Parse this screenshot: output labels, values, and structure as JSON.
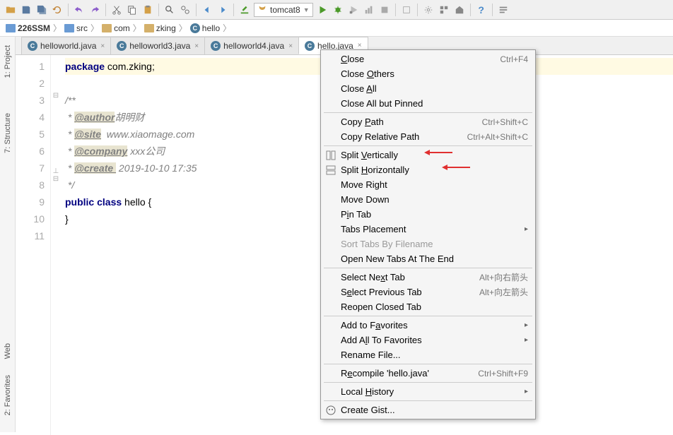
{
  "toolbar": {
    "tomcat_label": "tomcat8"
  },
  "breadcrumb": {
    "items": [
      "226SSM",
      "src",
      "com",
      "zking",
      "hello"
    ]
  },
  "tabs": [
    {
      "label": "helloworld.java",
      "active": false
    },
    {
      "label": "helloworld3.java",
      "active": false
    },
    {
      "label": "helloworld4.java",
      "active": false
    },
    {
      "label": "hello.java",
      "active": true
    }
  ],
  "side_tabs": {
    "project": "1: Project",
    "structure": "7: Structure",
    "web": "Web",
    "favorites": "2: Favorites"
  },
  "gutter_lines": [
    "1",
    "2",
    "3",
    "4",
    "5",
    "6",
    "7",
    "8",
    "9",
    "10",
    "11"
  ],
  "code": {
    "l1_kw": "package",
    "l1_pkg": " com.zking;",
    "l3": "/**",
    "l4_pre": " * ",
    "l4_tag": "@author",
    "l4_val": "胡明财",
    "l5_pre": " * ",
    "l5_tag": "@site",
    "l5_val": "  www.xiaomage.com",
    "l6_pre": " * ",
    "l6_tag": "@company",
    "l6_val": " xxx公司",
    "l7_pre": " * ",
    "l7_tag": "@create ",
    "l7_val": " 2019-10-10 17:35",
    "l8": " */",
    "l9_kw1": "public",
    "l9_sp1": " ",
    "l9_kw2": "class",
    "l9_rest": " hello {",
    "l10": "}"
  },
  "context_menu": {
    "close": "Close",
    "close_sc": "Ctrl+F4",
    "close_others": "Close Others",
    "close_all": "Close All",
    "close_pinned": "Close All but Pinned",
    "copy_path": "Copy Path",
    "copy_path_sc": "Ctrl+Shift+C",
    "copy_rel": "Copy Relative Path",
    "copy_rel_sc": "Ctrl+Alt+Shift+C",
    "split_v": "Split Vertically",
    "split_h": "Split Horizontally",
    "move_right": "Move Right",
    "move_down": "Move Down",
    "pin_tab": "Pin Tab",
    "tabs_placement": "Tabs Placement",
    "sort_tabs": "Sort Tabs By Filename",
    "open_new": "Open New Tabs At The End",
    "sel_next": "Select Next Tab",
    "sel_next_sc": "Alt+向右箭头",
    "sel_prev": "Select Previous Tab",
    "sel_prev_sc": "Alt+向左箭头",
    "reopen": "Reopen Closed Tab",
    "add_fav": "Add to Favorites",
    "add_all_fav": "Add All To Favorites",
    "rename": "Rename File...",
    "recompile": "Recompile 'hello.java'",
    "recompile_sc": "Ctrl+Shift+F9",
    "local_hist": "Local History",
    "create_gist": "Create Gist..."
  }
}
